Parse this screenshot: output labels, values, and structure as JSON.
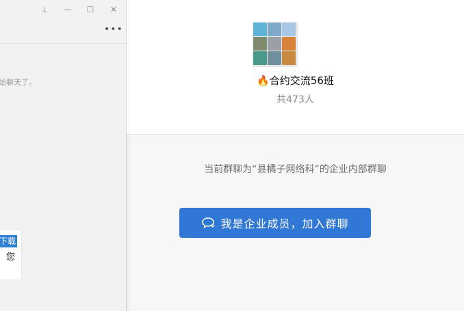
{
  "left_window": {
    "system_message": "始聊天了。",
    "card": {
      "highlight": "下载",
      "text": "您"
    },
    "controls": {
      "pin": "⊥",
      "minimize": "—",
      "maximize": "☐",
      "close": "✕",
      "more": "•••"
    }
  },
  "group": {
    "fire_icon": "🔥",
    "name": "合约交流56班",
    "members": "共473人",
    "avatar_tiles": [
      "#5fb3d6",
      "#7fa9c8",
      "#a9c7e2",
      "#7d8c6f",
      "#9aa0a5",
      "#d9823a",
      "#4a9a8b",
      "#6f8f9d",
      "#c78a3f"
    ]
  },
  "notice": "当前群聊为“县橘子网络科”的企业内部群聊",
  "join_button": {
    "label": "我是企业成员，加入群聊",
    "icon": "chat-bubble-icon"
  },
  "colors": {
    "accent": "#3078d4",
    "background": "#f7f7f7"
  }
}
